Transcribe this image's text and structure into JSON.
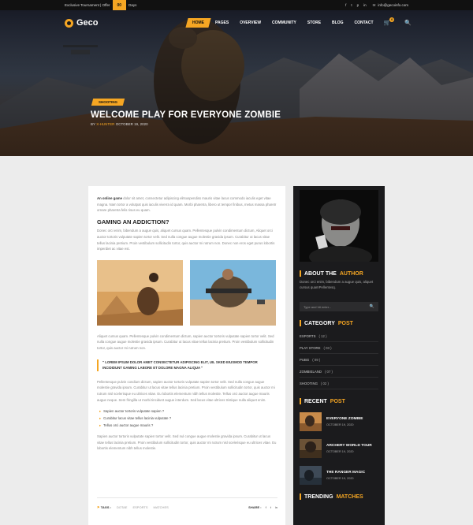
{
  "topbar": {
    "promo_text": "Exclusive Tournament | Offer",
    "badge": "00",
    "promo_suffix": "Days",
    "social_icons": [
      "facebook-icon",
      "twitter-icon",
      "pinterest-icon",
      "linkedin-icon"
    ],
    "email": "info@gecoinfo.com"
  },
  "nav": {
    "logo": "Geco",
    "items": [
      "HOME",
      "PAGES",
      "OVERVIEW",
      "COMMUNITY",
      "STORE",
      "BLOG",
      "CONTACT"
    ],
    "active": "HOME",
    "cart_count": "0"
  },
  "hero": {
    "category": "SHOOTING",
    "title": "WELCOME PLAY FOR EVERYONE ZOMBIE",
    "by": "BY",
    "author": "X-HUNTER",
    "date": "OCTOBER 19, 2020"
  },
  "article": {
    "intro_bold": "An online game",
    "intro": "dolor sit amet, consectetur adipiscing elitsuspendiss mauris vitae lacus commodo iaculis eget vitae magna. Nam tortor a volutpat quis iaculis viverra id quam. Morbi pharetra, libero ut tempor finibus, metus massa pharetr ornare pharetra felis risus eu quam.",
    "heading": "GAMING AN ADDICTION?",
    "para1": "Donec orci enim, bibendum a augue quis, aliquet cursus quam. Pellentesque pulvin condimentum dictum, Aliquet orci auctor tortoris vulputate sapien tortor velit. Sed nulla congue augue molestie gravida ipsum. Curabitur ut lacus vitae tellus lacinia pretium. Proin vestibulum sollicitudin tortor, quis auctor mi rutrum non. Donec non eros eget purus lobortis imperdiet ac vitae est.",
    "para2": "Aliquet cursus quam. Pellentesque pulvin condimentum dictum, sapien auctor tortoris vulputate sapien tortor velit. Sed nulla congue augue molestie gravida ipsum. Curabitur ut lacus vitae tellus lacinia pretium. Proin vestibulum sollicitudin tortor, quis auctor mi rutrum non.",
    "quote": "\" LOREM IPSUM DOLOR AMET CONSECTETUR ADIPISCING ELIT, UIL SKED EIUSMOD TEMPOR INCIDIDUNT GAMING LABORE ET DOLORE MAGNA ALIQUA \"",
    "para3": "Pellentesque pulvin condium dictum, sapien auctor tortoris vulputate sapien tortor velit. Sed nulla congue augue molestie gravida ipsum. Curabitur ut lacus vitae tellus lacinia pretium. Proin vestibulum sollicitudin tortor, quis auctor mi rutrum nisl scelerisque eu ultrices vitae. Eu lobortis elementum nibh tellus molestie. Tellus orci auctor augue mauris augue neque. Sem fringilla ut morbi tincidunt augue interdum. Sed lacus vitae ultrices tristique nulla aliquet enim.",
    "bullets": [
      "Sapien auctor tortoris vulputate sapien ?",
      "Curabitur lacus vitae tellus lacinia vulputate ?",
      "Tellus orci auctor augue mauris ?"
    ],
    "para4": "Sapien auctor tortoris vulputate sapien tortor velit. Sed nul congue augue molestie gravida ipsum. Curabitur ut lacus vitae tellus lacinia pretium. Proin vestibulum sollicitudin tortor, quis auctor mi rutrum nisl scelerisque eu ultrices vitae. Eu lobortis elementum nibh tellus molestie.",
    "tags_label": "TAGS :",
    "tags": [
      "DOTAE",
      "ESPORTS",
      "MATCHES"
    ],
    "share_label": "SHARE :",
    "share_icons": [
      "facebook-icon",
      "twitter-icon",
      "linkedin-icon"
    ]
  },
  "sidebar": {
    "about_title": "ABOUT THE",
    "about_title_hl": "AUTHOR",
    "about_text": "Donec orci enim, bibendum a augue quis, aliquet cursus quamPellentesq.",
    "search_placeholder": "Type and hit enter...",
    "category_title": "CATEGORY",
    "category_title_hl": "POST",
    "categories": [
      {
        "name": "ESPORTS",
        "count": "( 12 )"
      },
      {
        "name": "PLAY STORE",
        "count": "( 03 )"
      },
      {
        "name": "PUBG",
        "count": "( 09 )"
      },
      {
        "name": "ZOMBIELAND",
        "count": "( 07 )"
      },
      {
        "name": "SHOOTING",
        "count": "( 02 )"
      }
    ],
    "recent_title": "RECENT",
    "recent_title_hl": "POST",
    "posts": [
      {
        "title": "EVERYONE ZOMBIE",
        "date": "OCTOBER 19, 2020"
      },
      {
        "title": "ARCHERY WORLD TOUR",
        "date": "OCTOBER 19, 2020"
      },
      {
        "title": "THE RANGER MAGIC",
        "date": "OCTOBER 19, 2020"
      }
    ],
    "trending_title": "TRENDING",
    "trending_title_hl": "MATCHES"
  },
  "colors": {
    "accent": "#f5a623",
    "dark": "#1b1b1d"
  }
}
